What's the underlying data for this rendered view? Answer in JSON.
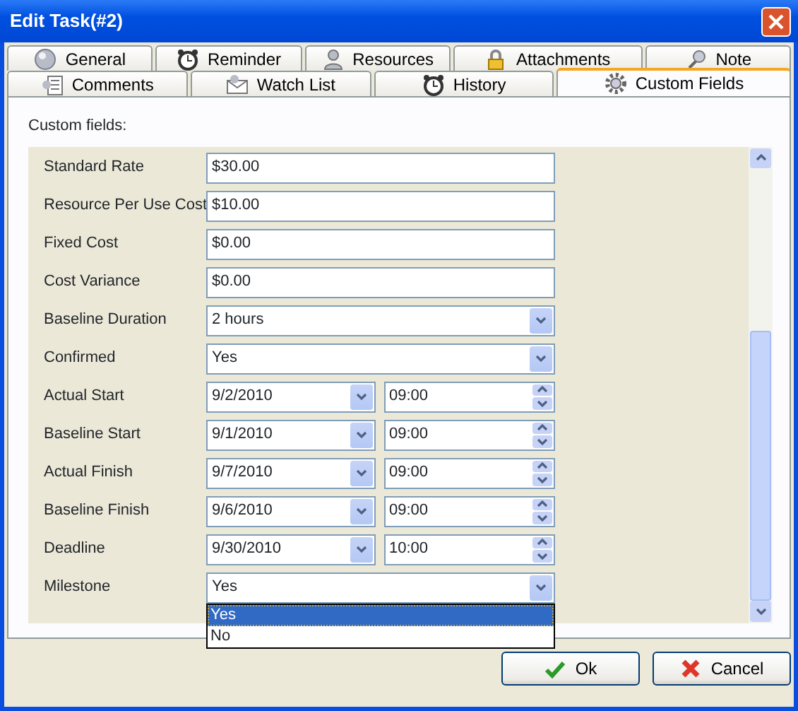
{
  "window": {
    "title": "Edit Task(#2)"
  },
  "tab_rows": [
    [
      {
        "label": "General",
        "selected": false
      },
      {
        "label": "Reminder",
        "selected": false
      },
      {
        "label": "Resources",
        "selected": false
      },
      {
        "label": "Attachments",
        "selected": false
      },
      {
        "label": "Note",
        "selected": false
      }
    ],
    [
      {
        "label": "Comments",
        "selected": false
      },
      {
        "label": "Watch List",
        "selected": false
      },
      {
        "label": "History",
        "selected": false
      },
      {
        "label": "Custom Fields",
        "selected": true
      }
    ]
  ],
  "section_label": "Custom fields:",
  "fields": [
    {
      "label": "Standard Rate",
      "kind": "text",
      "value": "$30.00"
    },
    {
      "label": "Resource Per Use Cost",
      "kind": "text",
      "value": "$10.00"
    },
    {
      "label": "Fixed Cost",
      "kind": "text",
      "value": "$0.00"
    },
    {
      "label": "Cost Variance",
      "kind": "text",
      "value": "$0.00"
    },
    {
      "label": "Baseline Duration",
      "kind": "combo",
      "value": "2 hours"
    },
    {
      "label": "Confirmed",
      "kind": "combo",
      "value": "Yes"
    },
    {
      "label": "Actual Start",
      "kind": "datetime",
      "value": "9/2/2010",
      "time": "09:00"
    },
    {
      "label": "Baseline Start",
      "kind": "datetime",
      "value": "9/1/2010",
      "time": "09:00"
    },
    {
      "label": "Actual Finish",
      "kind": "datetime",
      "value": "9/7/2010",
      "time": "09:00"
    },
    {
      "label": "Baseline Finish",
      "kind": "datetime",
      "value": "9/6/2010",
      "time": "09:00"
    },
    {
      "label": "Deadline",
      "kind": "datetime",
      "value": "9/30/2010",
      "time": "10:00"
    },
    {
      "label": "Milestone",
      "kind": "combo",
      "value": "Yes",
      "expanded": true,
      "options": [
        {
          "label": "Yes",
          "selected": true
        },
        {
          "label": "No",
          "selected": false
        }
      ]
    }
  ],
  "buttons": [
    {
      "label": "Ok"
    },
    {
      "label": "Cancel"
    }
  ]
}
